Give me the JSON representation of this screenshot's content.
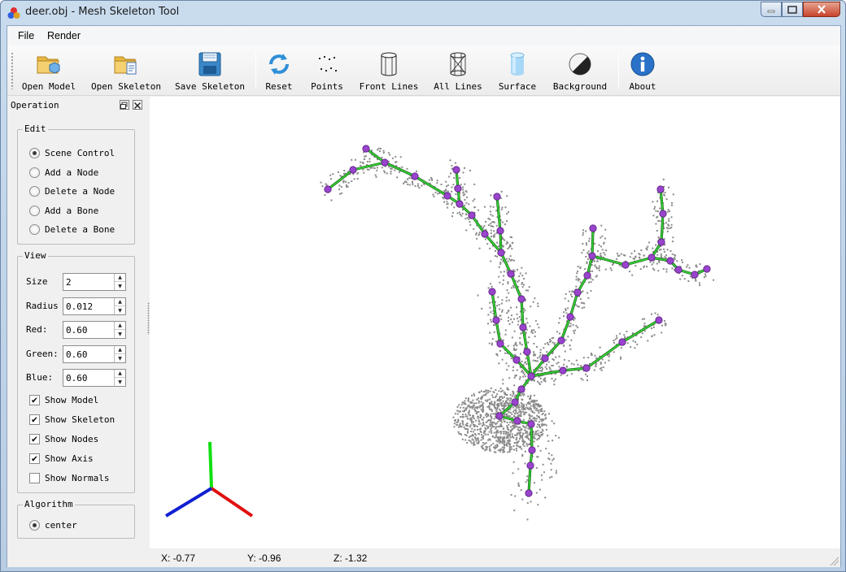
{
  "window": {
    "title": "deer.obj - Mesh Skeleton Tool"
  },
  "menu": {
    "items": [
      "File",
      "Render"
    ]
  },
  "toolbar": {
    "buttons": [
      {
        "label": "Open Model",
        "icon": "folder-open-model-icon"
      },
      {
        "label": "Open Skeleton",
        "icon": "folder-open-skeleton-icon"
      },
      {
        "label": "Save Skeleton",
        "icon": "save-disk-icon"
      },
      {
        "label": "Reset",
        "icon": "reset-arrows-icon"
      },
      {
        "label": "Points",
        "icon": "points-icon"
      },
      {
        "label": "Front Lines",
        "icon": "front-lines-icon"
      },
      {
        "label": "All Lines",
        "icon": "all-lines-icon"
      },
      {
        "label": "Surface",
        "icon": "surface-cylinder-icon"
      },
      {
        "label": "Background",
        "icon": "background-contrast-icon"
      },
      {
        "label": "About",
        "icon": "info-icon"
      }
    ]
  },
  "panel": {
    "title": "Operation",
    "edit": {
      "title": "Edit",
      "options": [
        "Scene Control",
        "Add a Node",
        "Delete a Node",
        "Add a Bone",
        "Delete a Bone"
      ],
      "selected": "Scene Control"
    },
    "view": {
      "title": "View",
      "fields": [
        {
          "label": "Size",
          "value": "2"
        },
        {
          "label": "Radius",
          "value": "0.012"
        },
        {
          "label": "Red:",
          "value": "0.60"
        },
        {
          "label": "Green:",
          "value": "0.60"
        },
        {
          "label": "Blue:",
          "value": "0.60"
        }
      ],
      "checks": [
        {
          "label": "Show Model",
          "checked": true
        },
        {
          "label": "Show Skeleton",
          "checked": true
        },
        {
          "label": "Show Nodes",
          "checked": true
        },
        {
          "label": "Show Axis",
          "checked": true
        },
        {
          "label": "Show Normals",
          "checked": false
        }
      ]
    },
    "algorithm": {
      "title": "Algorithm",
      "options": [
        "center"
      ],
      "selected": "center"
    }
  },
  "status": {
    "x": "X: -0.77",
    "y": "Y: -0.96",
    "z": "Z: -1.32"
  },
  "colors": {
    "skeleton_bone": "#33cc33",
    "node": "#9944cc",
    "point_cloud": "#8a8a8a",
    "axis_x": "#e01010",
    "axis_y": "#10e010",
    "axis_z": "#1020d0"
  }
}
